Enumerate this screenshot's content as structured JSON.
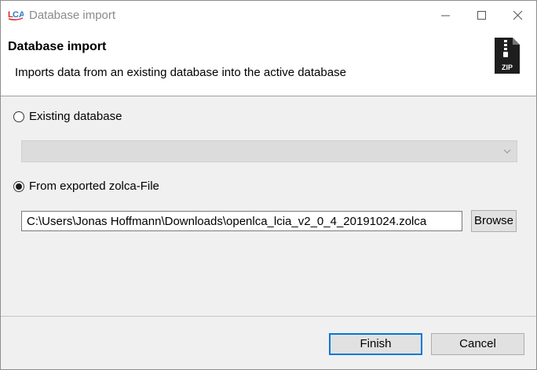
{
  "window": {
    "title": "Database import",
    "app_icon_text": "LCA"
  },
  "header": {
    "title": "Database import",
    "description": "Imports data from an existing database into the active database",
    "icon_label": "ZIP"
  },
  "options": {
    "existing_label": "Existing database",
    "existing_checked": false,
    "existing_selected": "",
    "zolca_label": "From exported zolca-File",
    "zolca_checked": true
  },
  "file": {
    "path": "C:\\Users\\Jonas Hoffmann\\Downloads\\openlca_lcia_v2_0_4_20191024.zolca",
    "browse_label": "Browse"
  },
  "footer": {
    "finish_label": "Finish",
    "cancel_label": "Cancel"
  },
  "colors": {
    "accent": "#0078d7",
    "app_icon_red": "#d9262b",
    "app_icon_blue": "#2f78c4"
  }
}
